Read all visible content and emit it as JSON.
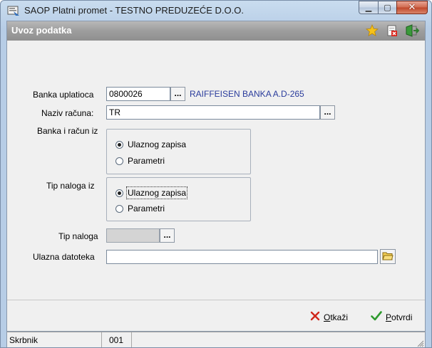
{
  "window": {
    "title": "SAOP Platni promet - TESTNO PREDUZEĆE D.O.O.",
    "minimize_glyph": "▁",
    "maximize_glyph": "▢",
    "close_glyph": "✕"
  },
  "dialog": {
    "title": "Uvoz podatka",
    "header_icons": [
      "star-icon",
      "delete-document-icon",
      "exit-icon"
    ]
  },
  "form": {
    "banka_uplatioca": {
      "label": "Banka uplatioca",
      "value": "0800026",
      "bank_name": "RAIFFEISEN BANKA  A.D-265",
      "button": "..."
    },
    "naziv_racuna": {
      "label": "Naziv računa:",
      "value": "TR",
      "button": "..."
    },
    "banka_i_racun_iz": {
      "label": "Banka i račun iz",
      "options": [
        "Ulaznog zapisa",
        "Parametri"
      ],
      "selected": "Ulaznog zapisa"
    },
    "tip_naloga_iz": {
      "label": "Tip naloga iz",
      "options": [
        "Ulaznog zapisa",
        "Parametri"
      ],
      "selected": "Ulaznog zapisa"
    },
    "tip_naloga": {
      "label": "Tip naloga",
      "value": "",
      "button": "..."
    },
    "ulazna_datoteka": {
      "label": "Ulazna datoteka",
      "value": ""
    }
  },
  "actions": {
    "cancel": {
      "prefix": "",
      "hotkey": "O",
      "rest": "tkaži"
    },
    "confirm": {
      "prefix": "",
      "hotkey": "P",
      "rest": "otvrdi"
    }
  },
  "status": {
    "user": "Skrbnik",
    "code": "001"
  },
  "colors": {
    "bank_name": "#2a3c9c",
    "header_band": "#9d9d9d",
    "cancel_x": "#d0281c",
    "confirm_check": "#2e9a2e"
  }
}
